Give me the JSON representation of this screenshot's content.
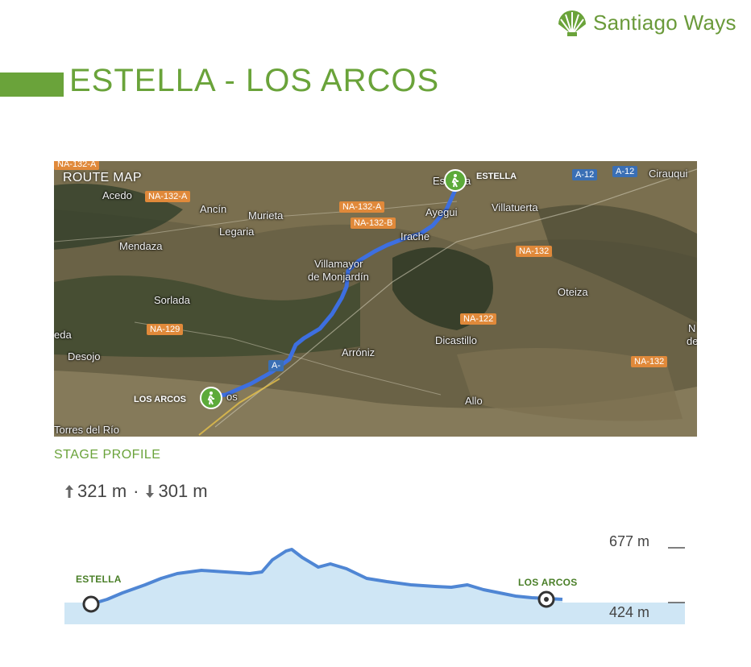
{
  "brand": {
    "name": "Santiago Ways",
    "color": "#6aa33a"
  },
  "stage_title": "ESTELLA - LOS ARCOS",
  "map": {
    "label": "ROUTE MAP",
    "start_label": "ESTELLA",
    "end_label": "LOS ARCOS",
    "places": [
      "Acedo",
      "Ancín",
      "Murieta",
      "Legaria",
      "Mendaza",
      "Villamayor",
      "de Monjardín",
      "Sorlada",
      "Desojo",
      "Arróniz",
      "Dicastillo",
      "Allo",
      "Oteiza",
      "Villatuerta",
      "Ayegui",
      "Irache",
      "Torres del Río",
      "Cirauqui",
      "Es",
      "a",
      "eda",
      "N",
      "de",
      "os"
    ],
    "roads": [
      "NA-132-A",
      "NA-132-A",
      "NA-132-B",
      "NA-132",
      "NA-122",
      "NA-129",
      "NA-132",
      "A-12",
      "A-12",
      "A-",
      "NA-132-A"
    ]
  },
  "profile": {
    "section_title": "STAGE PROFILE",
    "ascent": "321 m",
    "separator": "·",
    "descent": "301 m",
    "max_elev": "677 m",
    "min_elev": "424 m",
    "start_label": "ESTELLA",
    "end_label": "LOS ARCOS"
  }
}
